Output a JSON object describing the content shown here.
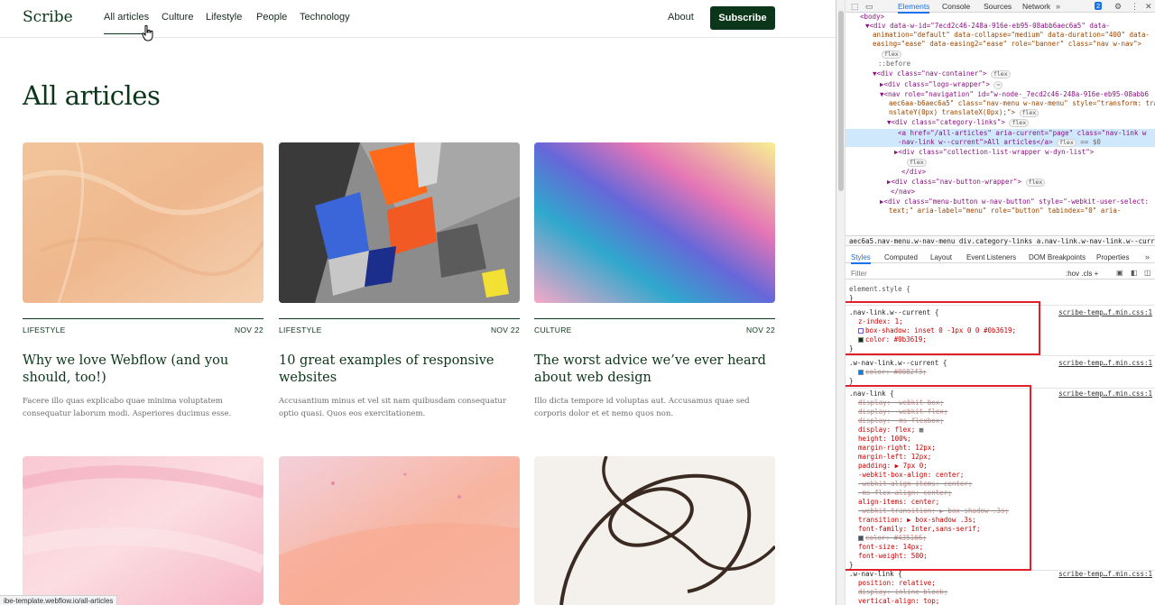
{
  "nav": {
    "logo": "Scribe",
    "links": [
      "All articles",
      "Culture",
      "Lifestyle",
      "People",
      "Technology"
    ],
    "about": "About",
    "subscribe": "Subscribe"
  },
  "page_title": "All articles",
  "cards": [
    {
      "category": "LIFESTYLE",
      "date": "NOV 22",
      "title": "Why we love Webflow (and you should, too!)",
      "excerpt": "Facere illo quas explicabo quae minima voluptatem consequatur laborum modi. Asperiores ducimus esse."
    },
    {
      "category": "LIFESTYLE",
      "date": "NOV 22",
      "title": "10 great examples of responsive websites",
      "excerpt": "Accusantium minus et vel sit nam quibusdam consequatur optio quasi. Quos eos exercitationem."
    },
    {
      "category": "CULTURE",
      "date": "NOV 22",
      "title": "The worst advice we’ve ever heard about web design",
      "excerpt": "Illo dicta tempore id voluptas aut. Accusamus quae sed corporis dolor et et nemo quos non."
    }
  ],
  "status_url": "ibe-template.webflow.io/all-articles",
  "devtools": {
    "tabs": [
      "Elements",
      "Console",
      "Sources",
      "Network"
    ],
    "badge": "2",
    "dom": [
      "<body>",
      "<div data-w-id=\"7ecd2c46-248a-916e-eb95-08abb6aec6a5\" data-",
      "animation=\"default\" data-collapse=\"medium\" data-duration=\"400\" data-",
      "easing=\"ease\" data-easing2=\"ease\" role=\"banner\" class=\"nav w-nav\">",
      "flex",
      "::before",
      "<div class=\"nav-container\">",
      "<div class=\"logo-wrapper\">",
      "<nav role=\"navigation\" id=\"w-node-_7ecd2c46-248a-916e-eb95-08abb6",
      "aec6aa-b6aec6a5\" class=\"nav-menu w-nav-menu\" style=\"transform: tra",
      "nslateY(0px) translateX(0px);\">",
      "<div class=\"category-links\">",
      "<a href=\"/all-articles\" aria-current=\"page\" class=\"nav-link w",
      "-nav-link w--current\">All articles</a>",
      "<div class=\"collection-list-wrapper w-dyn-list\">",
      "flex",
      "</div>",
      "<div class=\"nav-button-wrapper\">",
      "</nav>",
      "<div class=\"menu-button w-nav-button\" style=\"-webkit-user-select:",
      "text;\" aria-label=\"menu\" role=\"button\" tabindex=\"0\" aria-"
    ],
    "breadcrumbs": "aec6a5.nav-menu.w-nav-menu   div.category-links   a.nav-link.w-nav-link.w--current",
    "style_tabs": [
      "Styles",
      "Computed",
      "Layout",
      "Event Listeners",
      "DOM Breakpoints",
      "Properties"
    ],
    "filter": "Filter",
    "filter_tools": ":hov  .cls  +",
    "source": "scribe-temp…f.min.css:1",
    "rules": {
      "element_style": "element.style {",
      "current_sel": ".nav-link.w--current {",
      "current_props": [
        "z-index: 1;",
        "box-shadow:  inset 0 -1px 0 0  #0b3619;",
        "color:  #0b3619;"
      ],
      "wcurrent_sel": ".w-nav-link.w--current {",
      "wcurrent_prop": "color:  #0082f3;",
      "navlink_sel": ".nav-link {",
      "navlink_props": [
        {
          "t": "display: -webkit-box;",
          "s": true
        },
        {
          "t": "display: -webkit-flex;",
          "s": true
        },
        {
          "t": "display: -ms-flexbox;",
          "s": true
        },
        {
          "t": "display: flex;",
          "s": false
        },
        {
          "t": "height: 100%;",
          "s": false
        },
        {
          "t": "margin-right: 12px;",
          "s": false
        },
        {
          "t": "margin-left: 12px;",
          "s": false
        },
        {
          "t": "padding: ▶ 7px 0;",
          "s": false
        },
        {
          "t": "-webkit-box-align: center;",
          "s": false
        },
        {
          "t": "-webkit-align-items: center;",
          "s": true
        },
        {
          "t": "-ms-flex-align: center;",
          "s": true
        },
        {
          "t": "align-items: center;",
          "s": false
        },
        {
          "t": "-webkit-transition: ▶ box-shadow .3s;",
          "s": true
        },
        {
          "t": "transition: ▶ box-shadow .3s;",
          "s": false
        },
        {
          "t": "font-family: Inter,sans-serif;",
          "s": false
        },
        {
          "t": "color:  #435166;",
          "s": true
        },
        {
          "t": "font-size: 14px;",
          "s": false
        },
        {
          "t": "font-weight: 500;",
          "s": false
        }
      ],
      "wnav_sel": ".w-nav-link {",
      "wnav_props": [
        {
          "t": "position: relative;",
          "s": false
        },
        {
          "t": "display: inline-block;",
          "s": true
        },
        {
          "t": "vertical-align: top;",
          "s": false
        }
      ]
    },
    "colors": {
      "brand": "#0b3619",
      "webflow_blue": "#0082f3",
      "gray": "#435166"
    }
  }
}
